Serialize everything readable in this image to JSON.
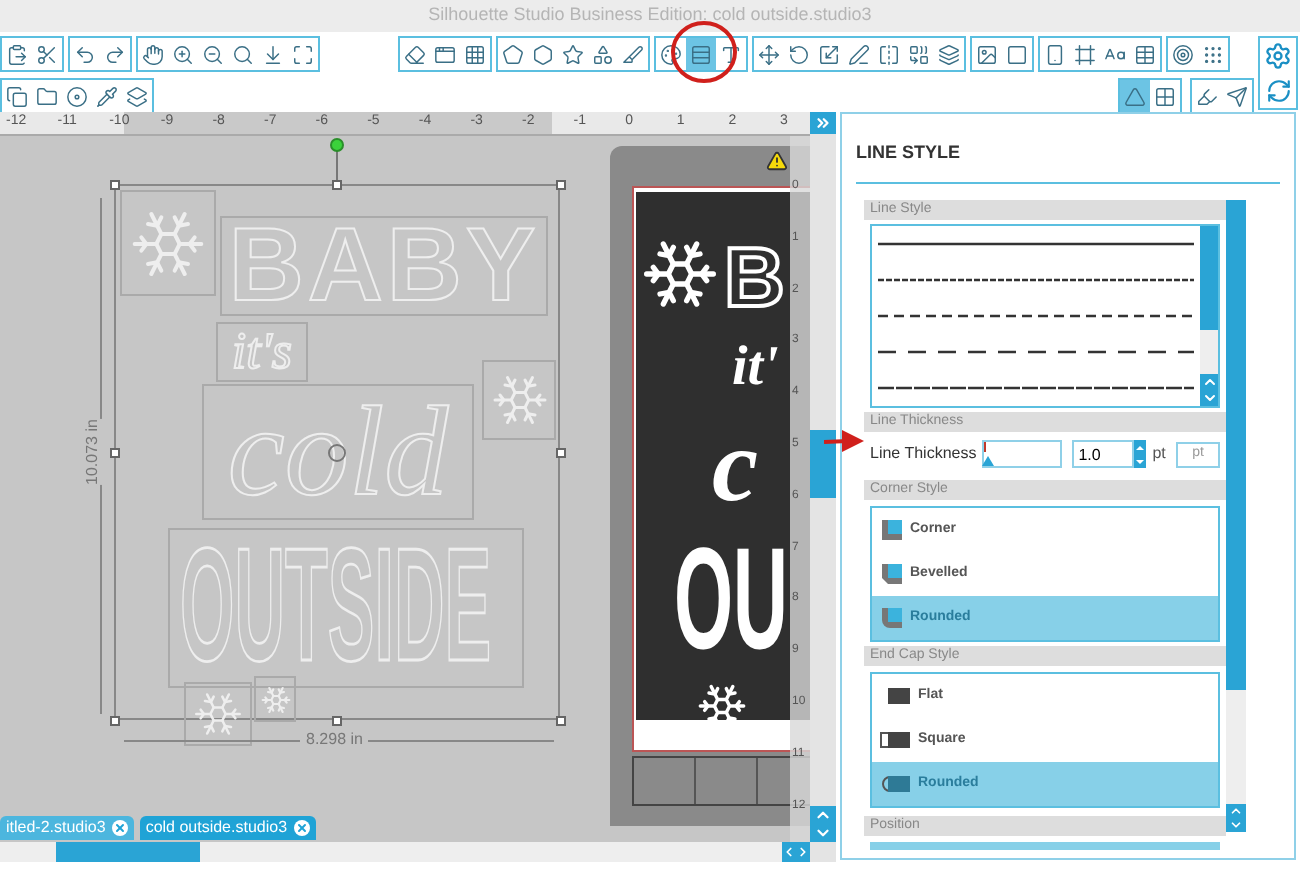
{
  "window": {
    "title": "Silhouette Studio Business Edition: cold outside.studio3"
  },
  "toolbar": {
    "row_1": [
      [
        {
          "selected": false
        },
        {
          "selected": false
        }
      ],
      [
        {
          "selected": false
        },
        {
          "selected": false
        }
      ],
      [
        {
          "selected": false
        },
        {
          "selected": false
        },
        {
          "selected": false
        },
        {
          "selected": false
        },
        {
          "selected": false
        },
        {
          "selected": false
        }
      ],
      [
        {
          "selected": false
        },
        {
          "selected": false
        },
        {
          "selected": false
        }
      ],
      [
        {
          "selected": false
        },
        {
          "selected": false
        },
        {
          "selected": false
        },
        {
          "selected": false
        },
        {
          "selected": false
        }
      ],
      [
        {
          "selected": false
        },
        {
          "selected": true
        },
        {
          "selected": false
        }
      ],
      [
        {
          "selected": false
        },
        {
          "selected": false
        },
        {
          "selected": false
        },
        {
          "selected": false
        },
        {
          "selected": false
        },
        {
          "selected": false
        },
        {
          "selected": false
        }
      ],
      [
        {
          "selected": false
        },
        {
          "selected": false
        }
      ],
      [
        {
          "selected": false
        },
        {
          "selected": false
        },
        {
          "selected": false
        },
        {
          "selected": false
        }
      ],
      [
        {
          "selected": false
        },
        {
          "selected": false
        }
      ]
    ],
    "row_2_left": [
      {
        "selected": false
      },
      {
        "selected": false
      },
      {
        "selected": false
      },
      {
        "selected": false
      },
      {
        "selected": false
      }
    ],
    "row_2_right": [
      [
        {
          "selected": true
        },
        {
          "selected": false
        }
      ],
      [
        {
          "selected": false
        },
        {
          "selected": false
        }
      ]
    ]
  },
  "ruler": {
    "top_labels": [
      "-12",
      "-11",
      "-10",
      "-9",
      "-8",
      "-7",
      "-6",
      "-5",
      "-4",
      "-3",
      "-2",
      "-1",
      "0",
      "1",
      "2",
      "3"
    ],
    "side_labels": [
      "0",
      "1",
      "2",
      "3",
      "4",
      "5",
      "6",
      "7",
      "8",
      "9",
      "10",
      "11",
      "12"
    ]
  },
  "canvas": {
    "design_words": [
      "BABY",
      "it's",
      "cold",
      "OUTSIDE"
    ],
    "height_dimension": "10.073 in",
    "width_dimension": "8.298 in",
    "preview_words": [
      "B",
      "it'",
      "c",
      "OU"
    ]
  },
  "document_tabs": [
    {
      "label": "itled-2.studio3",
      "selected": false
    },
    {
      "label": "cold outside.studio3",
      "selected": true
    }
  ],
  "panel": {
    "title": "LINE STYLE",
    "sections": [
      {
        "kind": "line_styles",
        "title": "Line Style"
      },
      {
        "kind": "thickness",
        "title": "Line Thickness",
        "label": "Line Thickness",
        "level": 0.02,
        "value": "1.0",
        "unit": "pt",
        "unit_button": "pt"
      },
      {
        "kind": "corner_options",
        "title": "Corner Style",
        "options": [
          {
            "label": "Corner",
            "selected": false
          },
          {
            "label": "Bevelled",
            "selected": false
          },
          {
            "label": "Rounded",
            "selected": true
          }
        ]
      },
      {
        "kind": "cap_options",
        "title": "End Cap Style",
        "options": [
          {
            "label": "Flat",
            "selected": false
          },
          {
            "label": "Square",
            "selected": false
          },
          {
            "label": "Rounded",
            "selected": true
          }
        ]
      },
      {
        "kind": "header",
        "title": "Position"
      }
    ]
  }
}
